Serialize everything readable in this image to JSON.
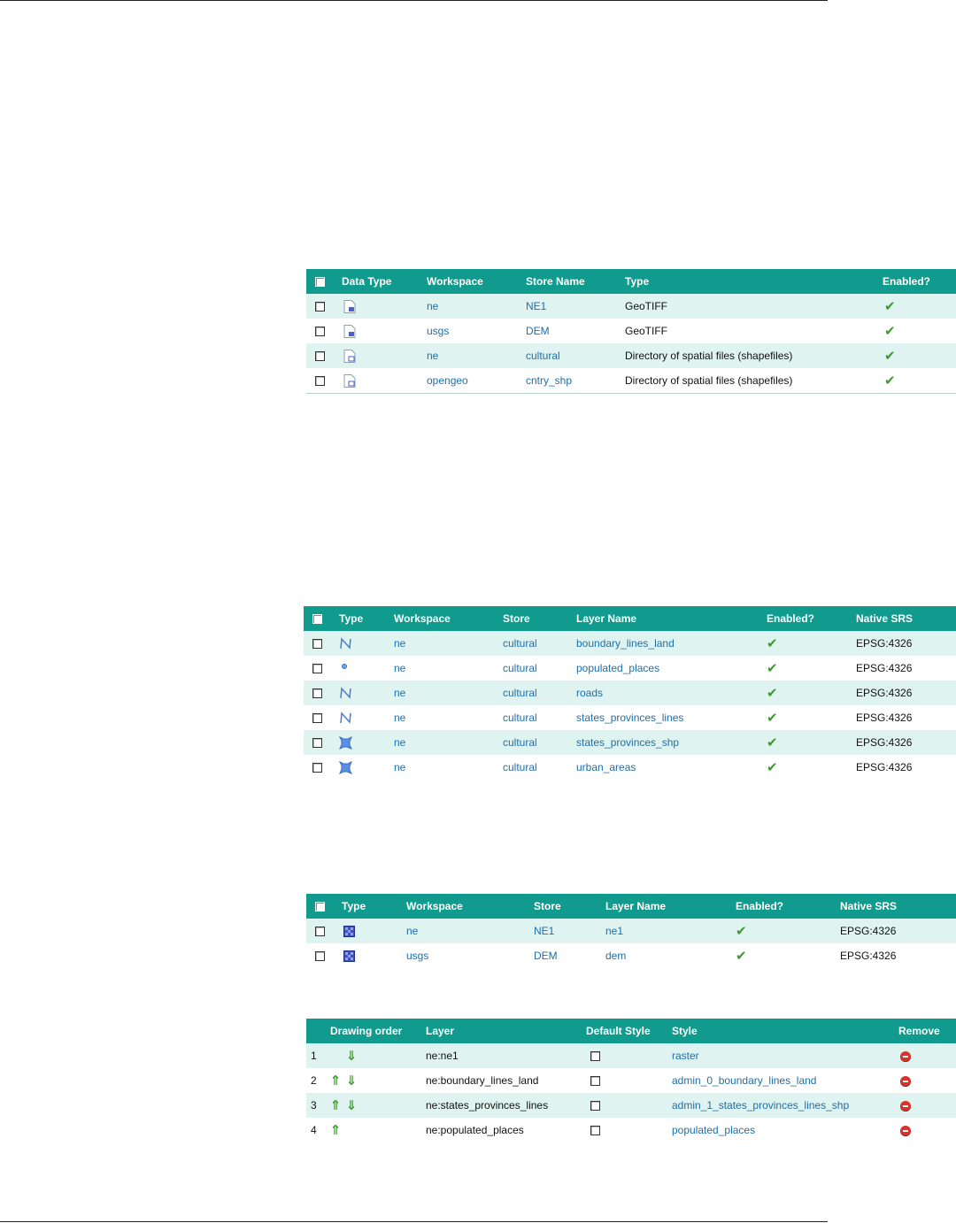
{
  "colors": {
    "header": "#109b8e",
    "stripe": "#dff3f0",
    "link": "#1f6fa8",
    "check": "#3c9a2c"
  },
  "stores_table": {
    "headers": {
      "data_type": "Data Type",
      "workspace": "Workspace",
      "store_name": "Store Name",
      "type": "Type",
      "enabled": "Enabled?"
    },
    "rows": [
      {
        "icon": "raster-file-icon",
        "workspace": "ne",
        "store": "NE1",
        "type": "GeoTIFF",
        "enabled": "✔"
      },
      {
        "icon": "raster-file-icon",
        "workspace": "usgs",
        "store": "DEM",
        "type": "GeoTIFF",
        "enabled": "✔"
      },
      {
        "icon": "vector-file-icon",
        "workspace": "ne",
        "store": "cultural",
        "type": "Directory of spatial files (shapefiles)",
        "enabled": "✔"
      },
      {
        "icon": "vector-file-icon",
        "workspace": "opengeo",
        "store": "cntry_shp",
        "type": "Directory of spatial files (shapefiles)",
        "enabled": "✔"
      }
    ]
  },
  "layers_table": {
    "headers": {
      "type": "Type",
      "workspace": "Workspace",
      "store": "Store",
      "layer_name": "Layer Name",
      "enabled": "Enabled?",
      "srs": "Native SRS"
    },
    "rows": [
      {
        "icon": "line-icon",
        "workspace": "ne",
        "store": "cultural",
        "layer": "boundary_lines_land",
        "enabled": "✔",
        "srs": "EPSG:4326"
      },
      {
        "icon": "point-icon",
        "workspace": "ne",
        "store": "cultural",
        "layer": "populated_places",
        "enabled": "✔",
        "srs": "EPSG:4326"
      },
      {
        "icon": "line-icon",
        "workspace": "ne",
        "store": "cultural",
        "layer": "roads",
        "enabled": "✔",
        "srs": "EPSG:4326"
      },
      {
        "icon": "line-icon",
        "workspace": "ne",
        "store": "cultural",
        "layer": "states_provinces_lines",
        "enabled": "✔",
        "srs": "EPSG:4326"
      },
      {
        "icon": "polygon-icon",
        "workspace": "ne",
        "store": "cultural",
        "layer": "states_provinces_shp",
        "enabled": "✔",
        "srs": "EPSG:4326"
      },
      {
        "icon": "polygon-icon",
        "workspace": "ne",
        "store": "cultural",
        "layer": "urban_areas",
        "enabled": "✔",
        "srs": "EPSG:4326"
      }
    ]
  },
  "raster_table": {
    "headers": {
      "type": "Type",
      "workspace": "Workspace",
      "store": "Store",
      "layer_name": "Layer Name",
      "enabled": "Enabled?",
      "srs": "Native SRS"
    },
    "rows": [
      {
        "icon": "raster-icon",
        "workspace": "ne",
        "store": "NE1",
        "layer": "ne1",
        "enabled": "✔",
        "srs": "EPSG:4326"
      },
      {
        "icon": "raster-icon",
        "workspace": "usgs",
        "store": "DEM",
        "layer": "dem",
        "enabled": "✔",
        "srs": "EPSG:4326"
      }
    ]
  },
  "group_table": {
    "headers": {
      "order": "Drawing order",
      "layer": "Layer",
      "default_style": "Default Style",
      "style": "Style",
      "remove": "Remove"
    },
    "rows": [
      {
        "num": "1",
        "up": "",
        "down": "⇓",
        "layer": "ne:ne1",
        "style": "raster"
      },
      {
        "num": "2",
        "up": "⇑",
        "down": "⇓",
        "layer": "ne:boundary_lines_land",
        "style": "admin_0_boundary_lines_land"
      },
      {
        "num": "3",
        "up": "⇑",
        "down": "⇓",
        "layer": "ne:states_provinces_lines",
        "style": "admin_1_states_provinces_lines_shp"
      },
      {
        "num": "4",
        "up": "⇑",
        "down": "",
        "layer": "ne:populated_places",
        "style": "populated_places"
      }
    ]
  }
}
